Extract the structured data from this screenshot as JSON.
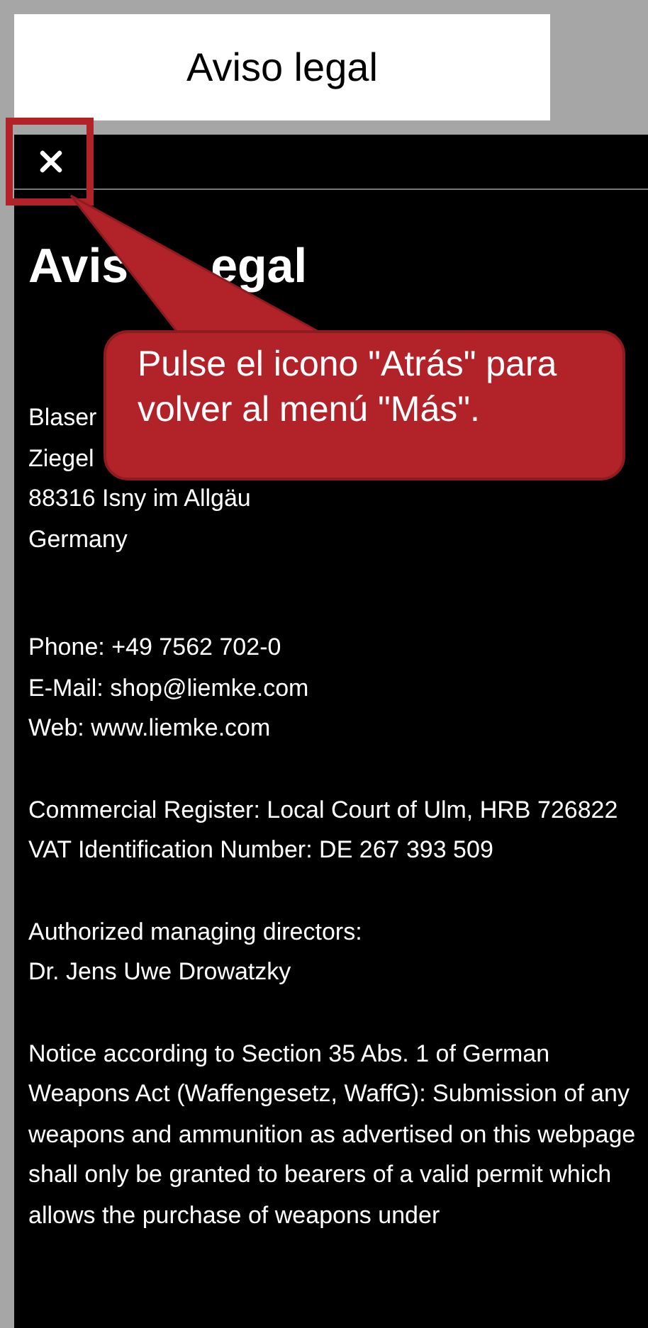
{
  "header": {
    "title": "Aviso legal"
  },
  "page": {
    "title_fragments": [
      "Avis",
      "egal"
    ],
    "blocks": [
      {
        "lines": [
          "Blaser",
          "Ziegel",
          "88316 Isny im Allgäu",
          "Germany"
        ]
      },
      {
        "lines": [
          "Phone: +49 7562 702-0",
          "E-Mail: shop@liemke.com",
          "Web: www.liemke.com"
        ]
      },
      {
        "lines": [
          "Commercial Register: Local Court of Ulm, HRB 726822",
          "VAT Identification Number: DE 267 393 509"
        ]
      },
      {
        "lines": [
          "Authorized managing directors:",
          "Dr. Jens Uwe Drowatzky"
        ]
      },
      {
        "lines": [
          "Notice according to Section 35 Abs. 1 of German Weapons Act (Waffengesetz, WaffG): Submission of any weapons and ammunition as advertised on this webpage shall only be granted to bearers of a valid permit which allows the purchase of weapons under"
        ]
      }
    ]
  },
  "callout": {
    "text": "Pulse el icono \"Atrás\" para volver al menú \"Más\"."
  }
}
